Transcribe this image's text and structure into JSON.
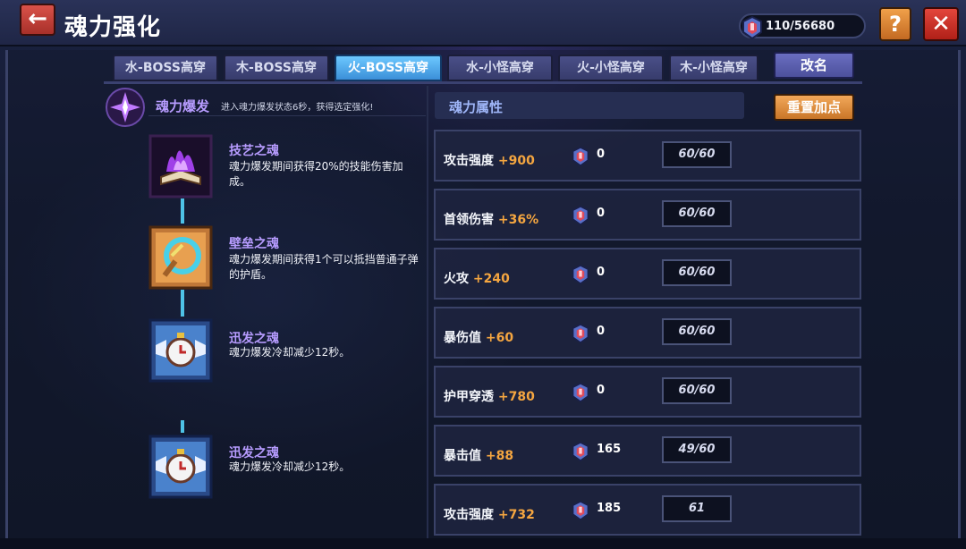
{
  "header": {
    "title": "魂力强化",
    "back_icon": "←",
    "currency_value": "110/56680",
    "help_label": "?",
    "close_label": "✕"
  },
  "tabs": [
    {
      "label": "水-BOSS高穿",
      "active": false
    },
    {
      "label": "木-BOSS高穿",
      "active": false
    },
    {
      "label": "火-BOSS高穿",
      "active": true
    },
    {
      "label": "水-小怪高穿",
      "active": false
    },
    {
      "label": "火-小怪高穿",
      "active": false
    },
    {
      "label": "木-小怪高穿",
      "active": false
    }
  ],
  "rename_label": "改名",
  "burst": {
    "title": "魂力爆发",
    "description": "进入魂力爆发状态6秒，获得选定强化!"
  },
  "skills": [
    {
      "name": "技艺之魂",
      "description": "魂力爆发期间获得20%的技能伤害加成。",
      "icon": "purple-flame-book-icon"
    },
    {
      "name": "壁垒之魂",
      "description": "魂力爆发期间获得1个可以抵挡普通子弹的护盾。",
      "icon": "shield-ring-icon"
    },
    {
      "name": "迅发之魂",
      "description": "魂力爆发冷却减少12秒。",
      "icon": "winged-clock-icon"
    },
    {
      "name": "迅发之魂",
      "description": "魂力爆发冷却减少12秒。",
      "icon": "winged-clock-icon"
    }
  ],
  "attributes_panel": {
    "title": "魂力属性",
    "reset_label": "重置加点"
  },
  "attributes": [
    {
      "name": "攻击强度",
      "bonus": "+900",
      "cost": "0",
      "level": "60/60"
    },
    {
      "name": "首领伤害",
      "bonus": "+36%",
      "cost": "0",
      "level": "60/60"
    },
    {
      "name": "火攻",
      "bonus": "+240",
      "cost": "0",
      "level": "60/60"
    },
    {
      "name": "暴伤值",
      "bonus": "+60",
      "cost": "0",
      "level": "60/60"
    },
    {
      "name": "护甲穿透",
      "bonus": "+780",
      "cost": "0",
      "level": "60/60"
    },
    {
      "name": "暴击值",
      "bonus": "+88",
      "cost": "165",
      "level": "49/60"
    },
    {
      "name": "攻击强度",
      "bonus": "+732",
      "cost": "185",
      "level": "61"
    }
  ],
  "colors": {
    "accent_purple": "#b79cff",
    "bonus_orange": "#f5a640",
    "active_tab": "#4aa8ee"
  }
}
